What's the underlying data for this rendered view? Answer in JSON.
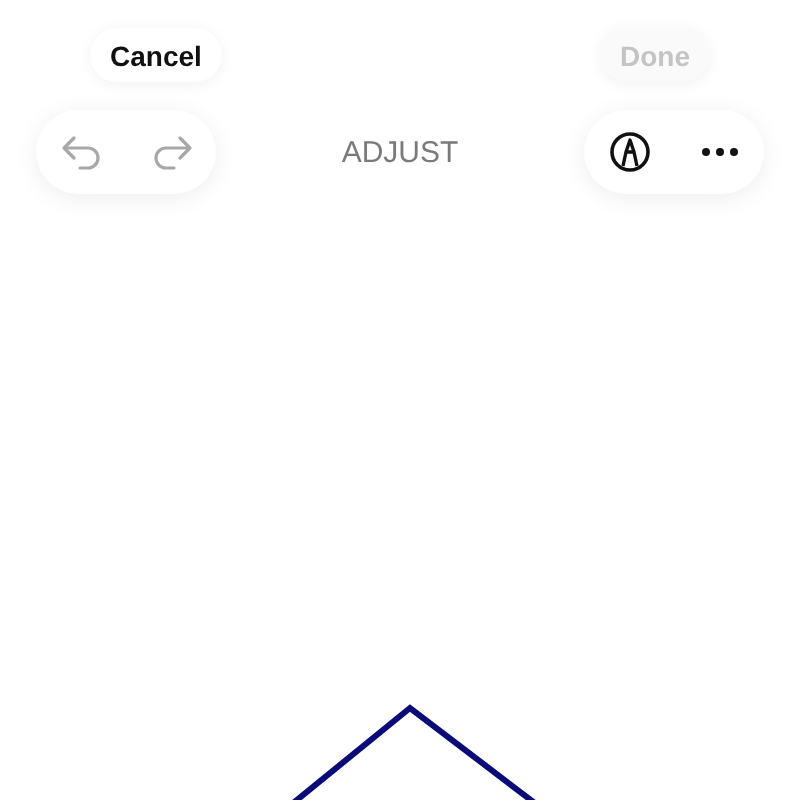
{
  "top_bar": {
    "cancel": {
      "label": "Cancel"
    },
    "done": {
      "label": "Done",
      "disabled": true
    }
  },
  "toolbar": {
    "undo": {
      "disabled": true
    },
    "redo": {
      "disabled": true
    },
    "title": "ADJUST"
  },
  "canvas": {
    "kind": "outline"
  }
}
